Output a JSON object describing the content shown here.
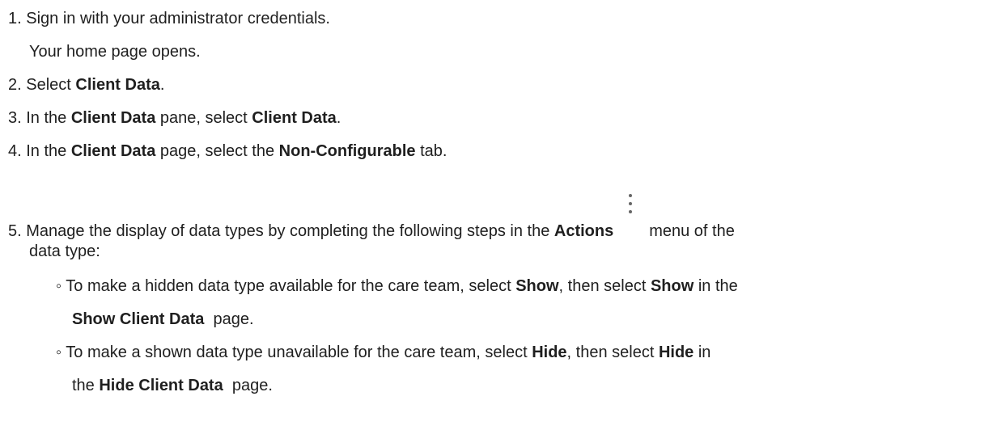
{
  "steps": [
    {
      "number": "1.",
      "text": "Sign in with your administrator credentials.",
      "result": "Your home page opens."
    },
    {
      "number": "2.",
      "pre": "Select ",
      "bold": "Client Data",
      "post": "."
    },
    {
      "number": "3.",
      "pre": "In the ",
      "bold1": "Client Data",
      "mid": " pane, select ",
      "bold2": "Client Data",
      "post": "."
    },
    {
      "number": "4.",
      "pre": "In the ",
      "bold1": "Client Data",
      "mid": " page, select the ",
      "bold2": "Non-Configurable",
      "post": " tab."
    },
    {
      "number": "5.",
      "pre": "Manage the display of data types by completing the following steps in the ",
      "bold": "Actions",
      "post": "menu of the",
      "cont": "data type:",
      "icon": "vertical-ellipsis-icon",
      "substeps": [
        {
          "bullet": "◦",
          "pre": "To make a hidden data type available for the care team, select ",
          "bold1": "Show",
          "mid": ", then select ",
          "bold2": "Show",
          "post": " in the",
          "cont_bold": "Show Client Data",
          "cont_post": "  page."
        },
        {
          "bullet": "◦",
          "pre": "To make a shown data type unavailable for the care team, select ",
          "bold1": "Hide",
          "mid": ", then select ",
          "bold2": "Hide",
          "post": " in",
          "cont_pre": "the ",
          "cont_bold": "Hide Client Data",
          "cont_post": "  page."
        }
      ]
    }
  ]
}
